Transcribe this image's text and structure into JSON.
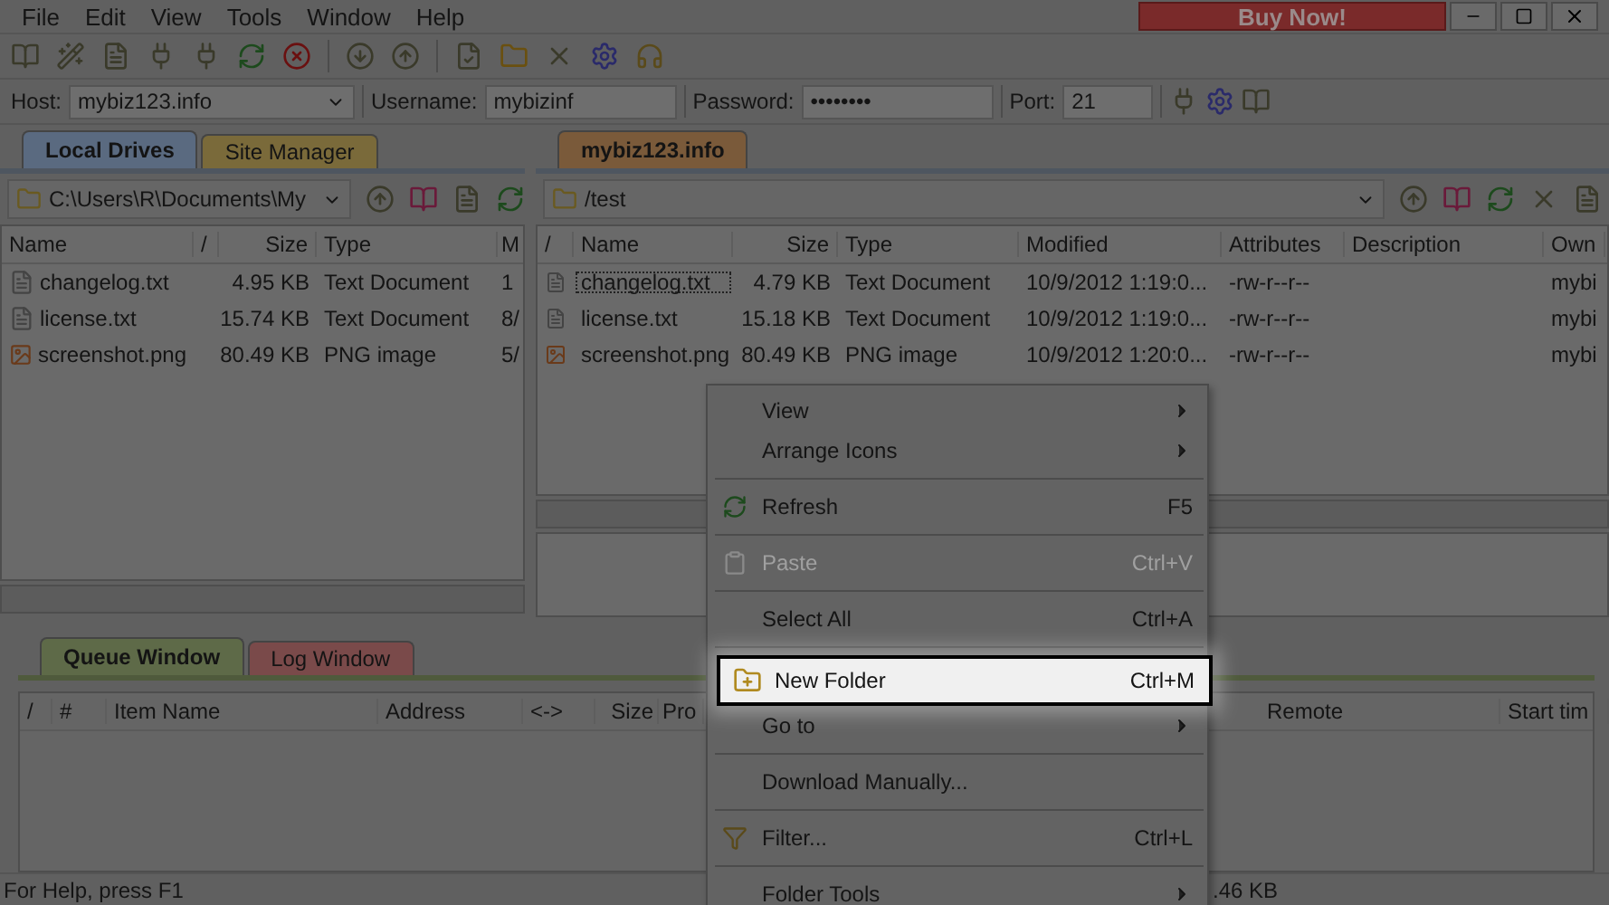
{
  "menu_bar": {
    "items": [
      "File",
      "Edit",
      "View",
      "Tools",
      "Window",
      "Help"
    ],
    "buy_button": "Buy Now!"
  },
  "connection": {
    "host_label": "Host:",
    "host": "mybiz123.info",
    "username_label": "Username:",
    "username": "mybizinf",
    "password_label": "Password:",
    "password": "••••••••",
    "port_label": "Port:",
    "port": "21"
  },
  "local_tabs": [
    {
      "label": "Local Drives",
      "selected": true
    },
    {
      "label": "Site Manager",
      "selected": false
    }
  ],
  "remote_tabs": [
    {
      "label": "mybiz123.info",
      "selected": true
    }
  ],
  "local": {
    "path": "C:\\Users\\R\\Documents\\My",
    "columns": [
      "Name",
      "/",
      "Size",
      "Type",
      "M"
    ],
    "rows": [
      {
        "kind": "text",
        "cells": [
          "changelog.txt",
          "",
          "4.95 KB",
          "Text Document",
          "1"
        ]
      },
      {
        "kind": "text",
        "cells": [
          "license.txt",
          "",
          "15.74 KB",
          "Text Document",
          "8/"
        ]
      },
      {
        "kind": "image",
        "cells": [
          "screenshot.png",
          "",
          "80.49 KB",
          "PNG image",
          "5/"
        ]
      }
    ]
  },
  "remote": {
    "path": "/test",
    "columns": [
      "/",
      "Name",
      "Size",
      "Type",
      "Modified",
      "Attributes",
      "Description",
      "Own"
    ],
    "rows": [
      {
        "kind": "text",
        "selected": true,
        "cells": [
          "",
          "changelog.txt",
          "4.79 KB",
          "Text Document",
          "10/9/2012 1:19:0...",
          "-rw-r--r--",
          "",
          "mybi"
        ]
      },
      {
        "kind": "text",
        "selected": false,
        "cells": [
          "",
          "license.txt",
          "15.18 KB",
          "Text Document",
          "10/9/2012 1:19:0...",
          "-rw-r--r--",
          "",
          "mybi"
        ]
      },
      {
        "kind": "image",
        "selected": false,
        "cells": [
          "",
          "screenshot.png",
          "80.49 KB",
          "PNG image",
          "10/9/2012 1:20:0...",
          "-rw-r--r--",
          "",
          "mybi"
        ]
      }
    ]
  },
  "queue_tabs": [
    {
      "label": "Queue Window",
      "selected": true
    },
    {
      "label": "Log Window",
      "selected": false
    }
  ],
  "queue_columns": [
    "/",
    "#",
    "Item Name",
    "Address",
    "<->",
    "Size",
    "Pro",
    "Remote",
    "Start tim"
  ],
  "context_menu": [
    {
      "kind": "item",
      "label": "View",
      "submenu": true,
      "disabled": false,
      "selected": false
    },
    {
      "kind": "item",
      "label": "Arrange Icons",
      "submenu": true,
      "disabled": false,
      "selected": false
    },
    {
      "kind": "separator"
    },
    {
      "kind": "item",
      "label": "Refresh",
      "shortcut": "F5",
      "submenu": false,
      "disabled": false,
      "selected": false
    },
    {
      "kind": "separator"
    },
    {
      "kind": "item",
      "label": "Paste",
      "shortcut": "Ctrl+V",
      "submenu": false,
      "disabled": true,
      "selected": false
    },
    {
      "kind": "separator"
    },
    {
      "kind": "item",
      "label": "Select All",
      "shortcut": "Ctrl+A",
      "submenu": false,
      "disabled": false,
      "selected": false
    },
    {
      "kind": "separator"
    },
    {
      "kind": "item",
      "label": "New Folder",
      "shortcut": "Ctrl+M",
      "submenu": false,
      "disabled": false,
      "selected": true
    },
    {
      "kind": "item",
      "label": "Go to",
      "submenu": true,
      "disabled": false,
      "selected": false
    },
    {
      "kind": "separator"
    },
    {
      "kind": "item",
      "label": "Download Manually...",
      "submenu": false,
      "disabled": false,
      "selected": false
    },
    {
      "kind": "separator"
    },
    {
      "kind": "item",
      "label": "Filter...",
      "shortcut": "Ctrl+L",
      "submenu": false,
      "disabled": false,
      "selected": false
    },
    {
      "kind": "separator"
    },
    {
      "kind": "item",
      "label": "Folder Tools",
      "submenu": true,
      "disabled": false,
      "selected": false
    }
  ],
  "status_bar": {
    "help": "For Help, press F1",
    "size": ".46 KB"
  }
}
